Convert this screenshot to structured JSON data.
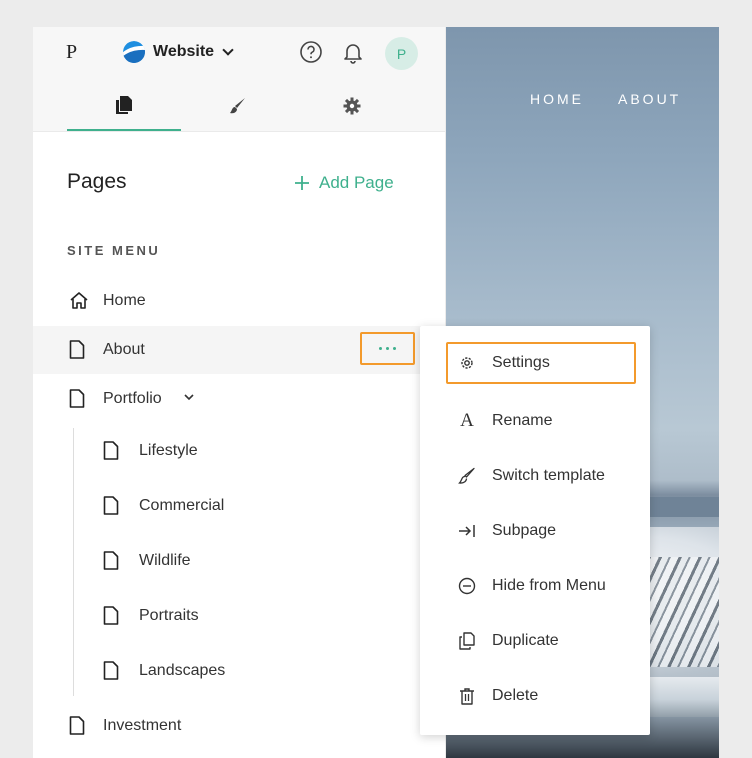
{
  "header": {
    "logo": "P",
    "site_name": "Website",
    "avatar_initial": "P"
  },
  "preview": {
    "nav": [
      "HOME",
      "ABOUT"
    ]
  },
  "pages_panel": {
    "title": "Pages",
    "add_page_label": "Add Page",
    "section_label": "SITE MENU",
    "items": [
      {
        "label": "Home",
        "icon": "home-icon"
      },
      {
        "label": "About",
        "icon": "page-icon"
      },
      {
        "label": "Portfolio",
        "icon": "page-icon"
      },
      {
        "label": "Lifestyle",
        "icon": "page-icon"
      },
      {
        "label": "Commercial",
        "icon": "page-icon"
      },
      {
        "label": "Wildlife",
        "icon": "page-icon"
      },
      {
        "label": "Portraits",
        "icon": "page-icon"
      },
      {
        "label": "Landscapes",
        "icon": "page-icon"
      },
      {
        "label": "Investment",
        "icon": "page-icon"
      }
    ]
  },
  "context_menu": {
    "items": [
      {
        "label": "Settings",
        "icon": "gear-icon"
      },
      {
        "label": "Rename",
        "icon": "text-icon"
      },
      {
        "label": "Switch template",
        "icon": "brush-icon"
      },
      {
        "label": "Subpage",
        "icon": "indent-icon"
      },
      {
        "label": "Hide from Menu",
        "icon": "hide-icon"
      },
      {
        "label": "Duplicate",
        "icon": "duplicate-icon"
      },
      {
        "label": "Delete",
        "icon": "trash-icon"
      }
    ]
  },
  "colors": {
    "accent": "#3fb08d",
    "highlight": "#f39a2c"
  }
}
